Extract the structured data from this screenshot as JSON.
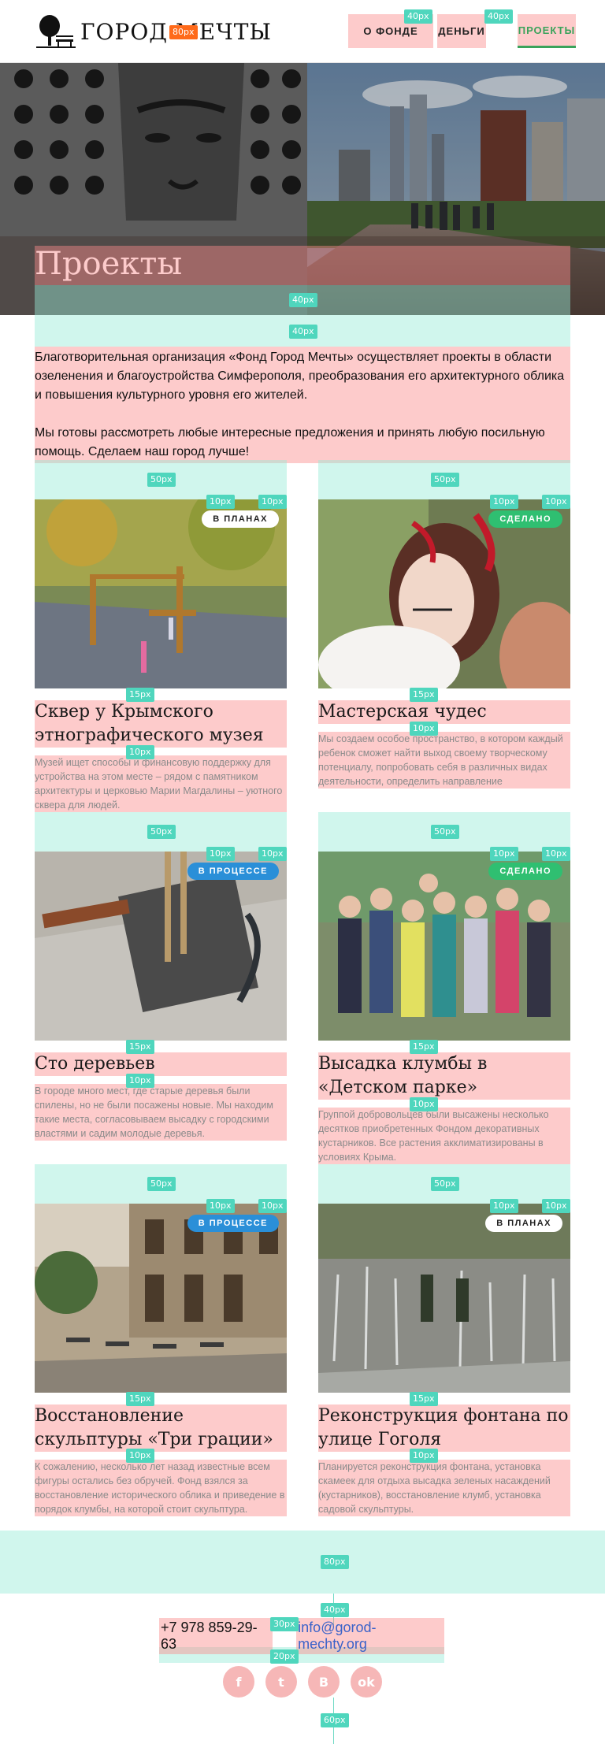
{
  "header": {
    "logo_text": "Город мечты",
    "nav": [
      {
        "label": "О фонде"
      },
      {
        "label": "Деньги"
      },
      {
        "label": "Проекты",
        "active": true
      }
    ]
  },
  "hero": {
    "title": "Проекты"
  },
  "intro": {
    "p1": "Благотворительная организация «Фонд Город Мечты» осуществляет проекты в области озеленения и благоустройства Симферополя, преобразования его архитектурного облика и повышения культурного уровня его жителей.",
    "p2": "Мы готовы рассмотреть любые интересные предложения и принять любую посильную помощь. Сделаем наш город лучше!"
  },
  "projects": [
    {
      "status": "В планах",
      "title": "Сквер у Крымского этнографического музея",
      "text": "Музей ищет способы и финансовую поддержку для устройства на этом месте – рядом с памятником архитектуры и церковью Марии Магдалины – уютного сквера для людей."
    },
    {
      "status": "Сделано",
      "title": "Мастерская чудес",
      "text": "Мы создаем особое пространство, в котором каждый ребенок сможет найти выход своему творческому потенциалу, попробовать себя в различных видах деятельности, определить направление"
    },
    {
      "status": "В процессе",
      "title": "Сто деревьев",
      "text": "В городе много мест, где старые деревья были спилены, но не были посажены новые. Мы находим такие места, согласовываем высадку с городскими властями и садим молодые деревья."
    },
    {
      "status": "Сделано",
      "title": "Высадка клумбы в «Детском парке»",
      "text": "Группой добровольцев были высажены несколько десятков приобретенных Фондом декоративных кустарников. Все растения акклиматизированы в условиях Крыма."
    },
    {
      "status": "В процессе",
      "title": "Восстановление скульптуры «Три грации»",
      "text": "К сожалению, несколько лет назад известные всем фигуры остались без обручей. Фонд взялся за восстановление исторического облика и приведение в порядок клумбы, на которой стоит скульптура."
    },
    {
      "status": "В планах",
      "title": "Реконструкция фонтана по улице Гоголя",
      "text": "Планируется реконструкция фонтана, установка скамеек для отдыха высадка зеленых насаждений (кустарников), восстановление клумб, установка садовой скульптуры."
    }
  ],
  "footer": {
    "phone": "+7 978 859-29-63",
    "email": "info@gorod-mechty.org",
    "socials": [
      {
        "icon": "facebook-icon",
        "glyph": "f"
      },
      {
        "icon": "twitter-icon",
        "glyph": "t"
      },
      {
        "icon": "vk-icon",
        "glyph": "В"
      },
      {
        "icon": "odnoklassniki-icon",
        "glyph": "ok"
      }
    ]
  },
  "guides": {
    "g80": "80px",
    "g40": "40px",
    "g50": "50px",
    "g15": "15px",
    "g10": "10px",
    "g30": "30px",
    "g20": "20px",
    "g60": "60px"
  },
  "colors": {
    "accent_green": "#3aa35b",
    "badge_done": "#2fbf71",
    "badge_progress": "#2a8fd8",
    "link_blue": "#3b63c9"
  }
}
